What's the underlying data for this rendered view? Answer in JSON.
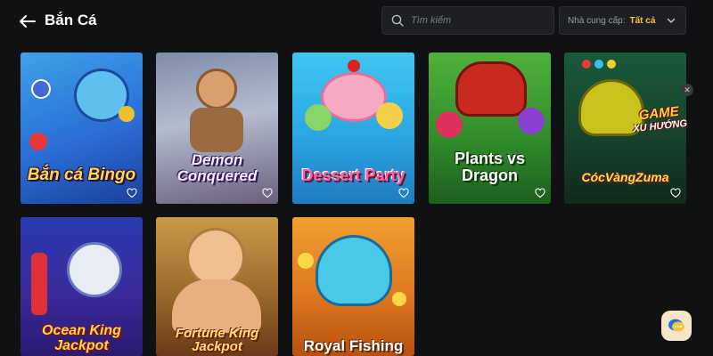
{
  "header": {
    "title": "Bắn Cá",
    "search_placeholder": "Tìm kiếm",
    "provider_label": "Nhà cung cấp:",
    "provider_value": "Tất cả"
  },
  "games": [
    {
      "title": "Bắn cá Bingo"
    },
    {
      "title": "Demon Conquered"
    },
    {
      "title": "Dessert Party"
    },
    {
      "title": "Plants vs Dragon"
    },
    {
      "title": "CócVàngZuma"
    },
    {
      "title": "Ocean King Jackpot"
    },
    {
      "title": "Fortune King Jackpot"
    },
    {
      "title": "Royal Fishing"
    }
  ],
  "trend_badge": {
    "line1": "GAME",
    "line2": "XU HƯỚNG"
  },
  "icons": {
    "back": "arrow-left-icon",
    "search": "search-icon",
    "chevron": "chevron-down-icon",
    "favorite": "heart-icon",
    "chat": "chat-icon"
  },
  "colors": {
    "background": "#101112",
    "accent": "#f5c542"
  }
}
